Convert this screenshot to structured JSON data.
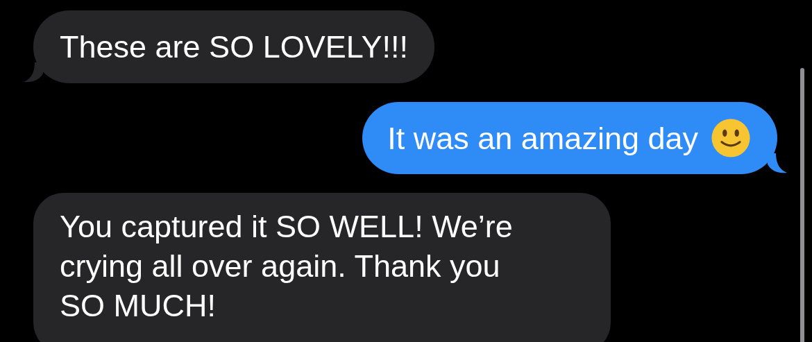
{
  "messages": [
    {
      "kind": "incoming",
      "text": "These are SO LOVELY!!!",
      "tail": true
    },
    {
      "kind": "outgoing",
      "text": "It was an amazing day",
      "smiley": true,
      "tail": true
    },
    {
      "kind": "incoming",
      "text": "You captured it SO WELL! We’re crying all over again. Thank you SO MUCH!",
      "tail": false
    }
  ]
}
